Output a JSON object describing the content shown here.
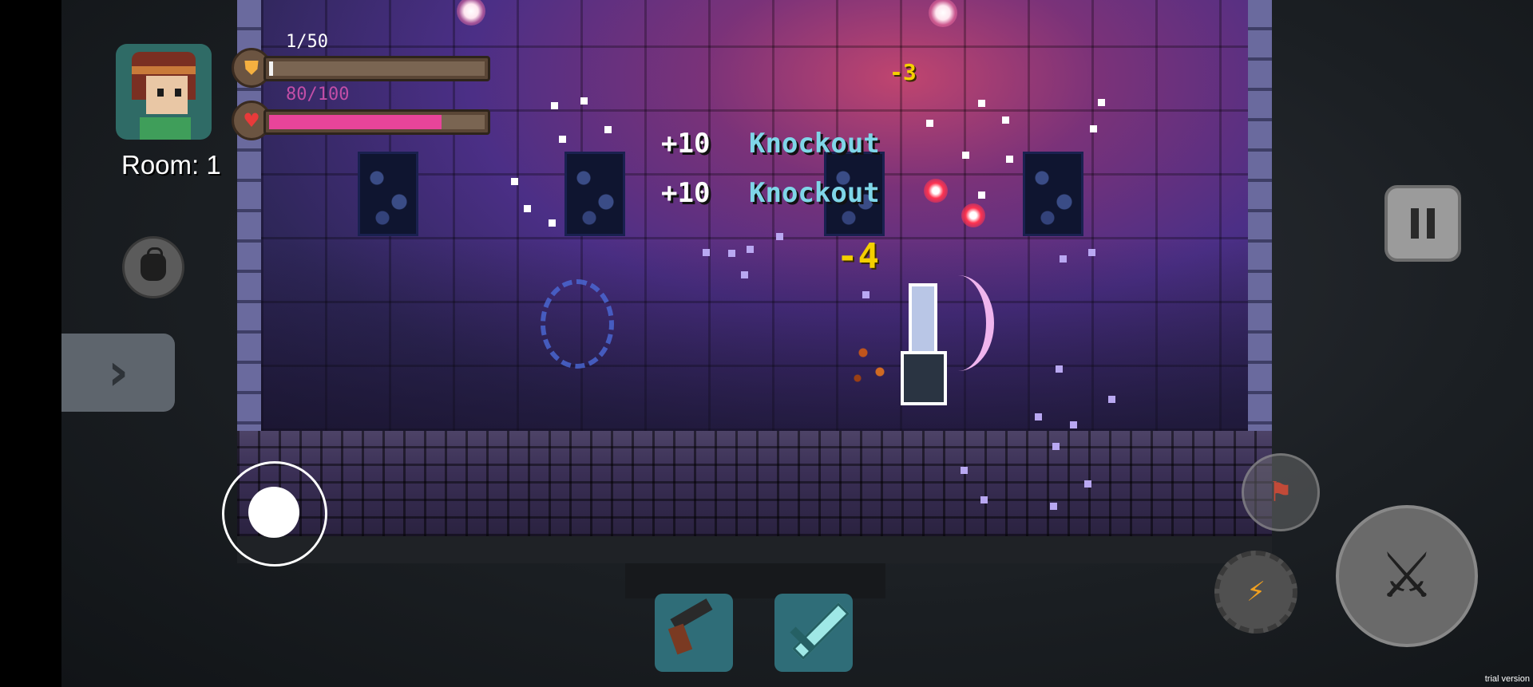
{
  "hud": {
    "room_label": "Room: 1",
    "shield_text": "1/50",
    "shield_fraction": 0.02,
    "health_text": "80/100",
    "health_fraction": 0.8,
    "shield_icon": "shield-icon",
    "health_icon": "heart-icon",
    "avatar": "player-portrait"
  },
  "combat_text": [
    {
      "points": "+10",
      "label": "Knockout"
    },
    {
      "points": "+10",
      "label": "Knockout"
    }
  ],
  "damage_numbers": [
    "-3",
    "-4"
  ],
  "controls": {
    "side_tab_glyph": "›",
    "skill_glyph": "⚑",
    "bolt_glyph": "⚡",
    "attack_glyph": "⚔"
  },
  "weapons": [
    {
      "name": "pistol-icon"
    },
    {
      "name": "sword-icon"
    }
  ],
  "watermark": "trial version",
  "colors": {
    "health_fill": "#e8449a",
    "shield_fill": "#f3f3f3",
    "health_text": "#c24ea6",
    "shield_text": "#ffffff",
    "knockout": "#7fd6e8",
    "damage": "#f5d000"
  }
}
